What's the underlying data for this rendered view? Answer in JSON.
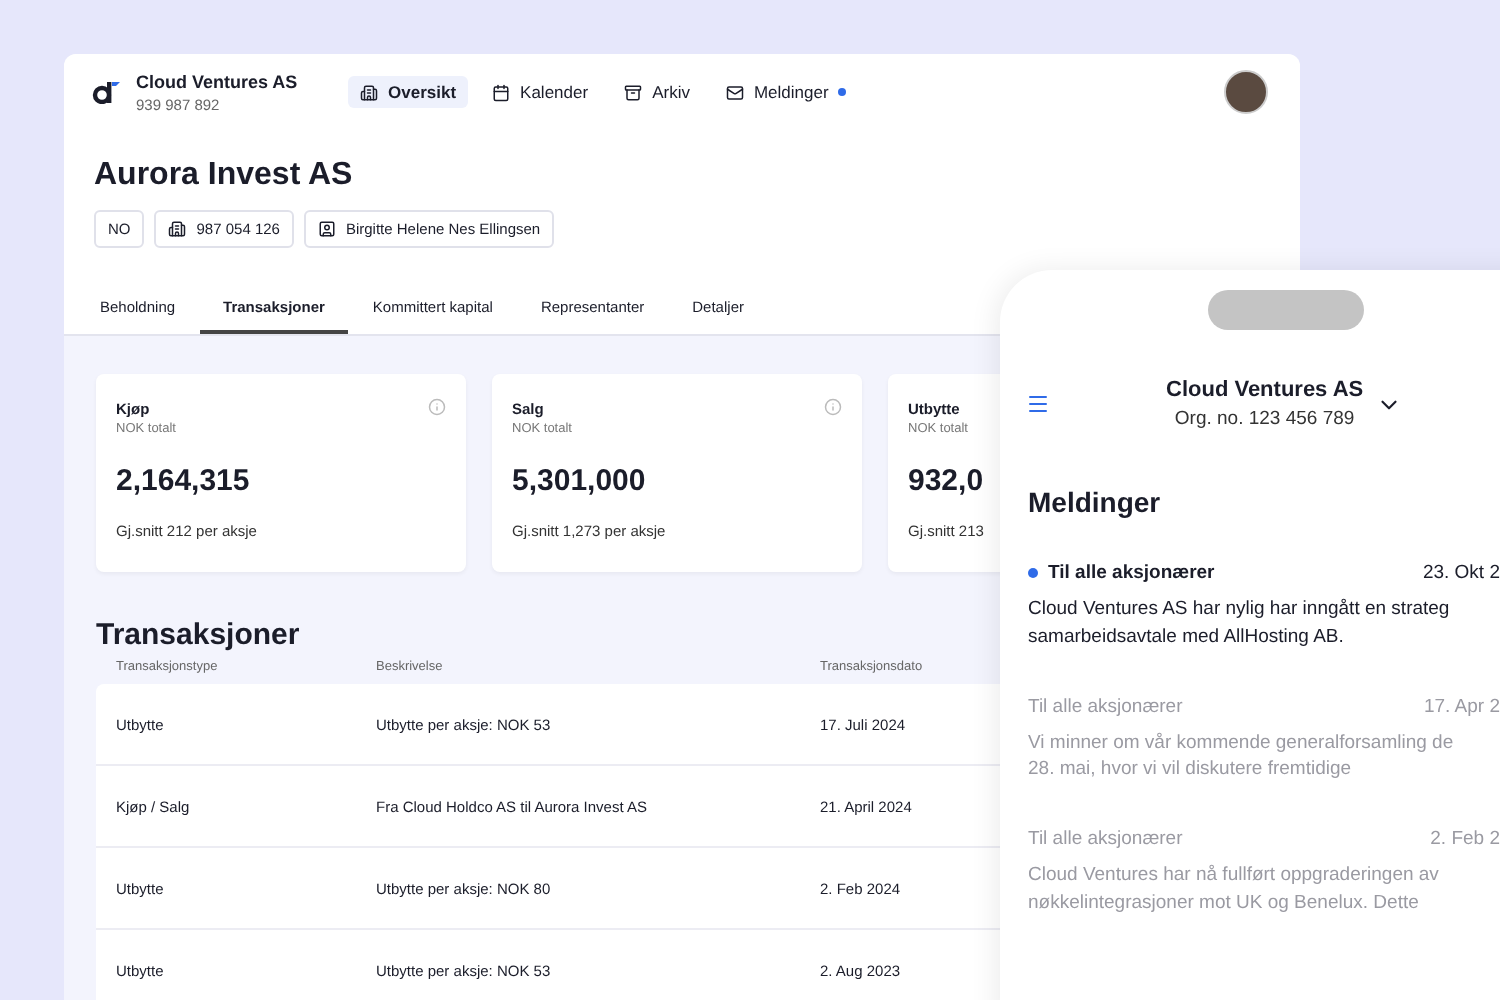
{
  "company": {
    "name": "Cloud Ventures AS",
    "number": "939 987 892"
  },
  "nav": [
    {
      "label": "Oversikt",
      "selected": true,
      "dot": false
    },
    {
      "label": "Kalender",
      "selected": false,
      "dot": false
    },
    {
      "label": "Arkiv",
      "selected": false,
      "dot": false
    },
    {
      "label": "Meldinger",
      "selected": false,
      "dot": true
    }
  ],
  "title": "Aurora Invest AS",
  "chips": [
    "NO",
    "987 054 126",
    "Birgitte Helene Nes Ellingsen"
  ],
  "tabs": [
    {
      "label": "Beholdning",
      "selected": false
    },
    {
      "label": "Transaksjoner",
      "selected": true
    },
    {
      "label": "Kommittert kapital",
      "selected": false
    },
    {
      "label": "Representanter",
      "selected": false
    },
    {
      "label": "Detaljer",
      "selected": false
    }
  ],
  "cards": [
    {
      "title": "Kjøp",
      "subtitle": "NOK totalt",
      "value": "2,164,315",
      "note": "Gj.snitt 212 per aksje"
    },
    {
      "title": "Salg",
      "subtitle": "NOK totalt",
      "value": "5,301,000",
      "note": "Gj.snitt 1,273 per aksje"
    },
    {
      "title": "Utbytte",
      "subtitle": "NOK totalt",
      "value": "932,0",
      "note": "Gj.snitt 213"
    }
  ],
  "table": {
    "title": "Transaksjoner",
    "columns": [
      "Transaksjonstype",
      "Beskrivelse",
      "Transaksjonsdato"
    ],
    "rows": [
      [
        "Utbytte",
        "Utbytte per aksje: NOK 53",
        "17. Juli 2024"
      ],
      [
        "Kjøp / Salg",
        "Fra Cloud Holdco AS til Aurora Invest AS",
        "21. April 2024"
      ],
      [
        "Utbytte",
        "Utbytte per aksje: NOK 80",
        "2. Feb 2024"
      ],
      [
        "Utbytte",
        "Utbytte per aksje: NOK 53",
        "2. Aug 2023"
      ]
    ]
  },
  "phone": {
    "company": "Cloud Ventures AS",
    "org": "Org. no. 123 456 789",
    "heading": "Meldinger",
    "messages": [
      {
        "to": "Til alle aksjonærer",
        "date": "23. Okt 2",
        "body_lines": [
          "Cloud Ventures AS har nylig har inngått en strateg",
          "samarbeidsavtale med AllHosting AB."
        ],
        "unread": true
      },
      {
        "to": "Til alle aksjonærer",
        "date": "17. Apr 2",
        "body_lines": [
          "Vi minner om vår kommende generalforsamling de",
          "28. mai, hvor vi vil diskutere fremtidige"
        ],
        "unread": false
      },
      {
        "to": "Til alle aksjonærer",
        "date": "2. Feb 2",
        "body_lines": [
          "Cloud Ventures har nå fullført oppgraderingen av",
          "nøkkelintegrasjoner mot UK og Benelux. Dette"
        ],
        "unread": false
      }
    ]
  }
}
